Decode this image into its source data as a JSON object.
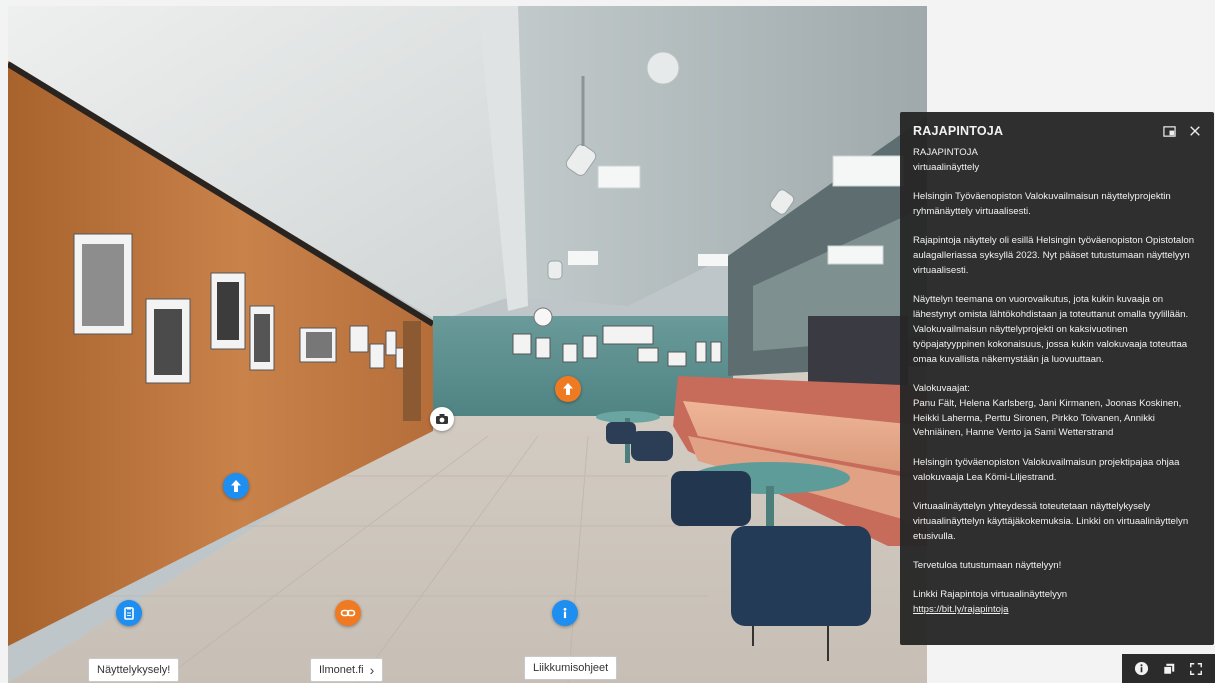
{
  "hotspot_labels": {
    "survey": "Näyttelykysely!",
    "ilmonet": "Ilmonet.fi",
    "ilmonet_arrow": "›",
    "controls": "Liikkumisohjeet"
  },
  "info_panel": {
    "title": "RAJAPINTOJA",
    "subtitle": "RAJAPINTOJA",
    "kind": "virtuaalinäyttely",
    "paragraphs": [
      "Helsingin Työväenopiston Valokuvailmaisun näyttelyprojektin ryhmänäyttely virtuaalisesti.",
      "Rajapintoja näyttely oli esillä Helsingin työväenopiston Opistotalon aulagalleriassa syksyllä 2023. Nyt pääset tutustumaan näyttelyyn virtuaalisesti.",
      "Näyttelyn teemana on vuorovaikutus, jota kukin kuvaaja on lähestynyt omista lähtökohdistaan ja toteuttanut omalla tyylillään. Valokuvailmaisun näyttelyprojekti on kaksivuotinen työpajatyyppinen kokonaisuus, jossa kukin valokuvaaja toteuttaa omaa kuvallista näkemystään ja luovuuttaan."
    ],
    "photographers_heading": "Valokuvaajat:",
    "photographers": "Panu Fält, Helena Karlsberg, Jani Kirmanen, Joonas Koskinen, Heikki Laherma, Perttu Sironen, Pirkko Toivanen, Annikki Vehniäinen, Hanne Vento ja Sami Wetterstrand",
    "paragraphs2": [
      "Helsingin työväenopiston Valokuvailmaisun projektipajaa ohjaa valokuvaaja Lea Kömi-Liljestrand.",
      "Virtuaalinäyttelyn yhteydessä toteutetaan näyttelykysely virtuaalinäyttelyn käyttäjäkokemuksia. Linkki on virtuaalinäyttelyn etusivulla.",
      "Tervetuloa tutustumaan näyttelyyn!"
    ],
    "link_intro": "Linkki Rajapintoja virtuaalinäyttelyyn",
    "link_text": "https://bit.ly/rajapintoja"
  },
  "icons": {
    "panel_expand": "expand-panel-icon",
    "panel_close": "close-icon",
    "toolbar": [
      "info-icon",
      "layers-icon",
      "fullscreen-icon"
    ]
  },
  "colors": {
    "hotspot_blue": "#1e8ef0",
    "hotspot_orange": "#ef7a22",
    "panel_bg": "#262626",
    "wall_wood": "#c0773a",
    "wall_teal": "#5a8f8f",
    "sofa": "#e8a98a"
  }
}
